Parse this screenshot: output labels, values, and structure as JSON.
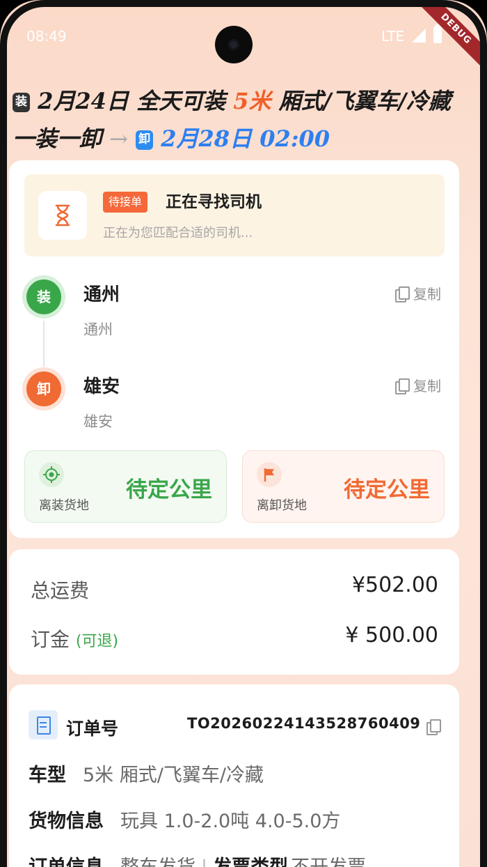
{
  "status_bar": {
    "time": "08:49",
    "network": "LTE"
  },
  "debug_label": "DEBUG",
  "header": {
    "load_tag": "装",
    "load_date": "2月24日",
    "load_window": "全天可装",
    "truck_length": "5米",
    "truck_types": "厢式/飞翼车/冷藏",
    "mode": "一装一卸",
    "arrow": "→",
    "unload_tag": "卸",
    "unload_datetime": "2月28日 02:00"
  },
  "status": {
    "badge": "待接单",
    "title": "正在寻找司机",
    "subtitle": "正在为您匹配合适的司机..."
  },
  "route": {
    "load": {
      "marker": "装",
      "name": "通州",
      "detail": "通州",
      "copy_label": "复制"
    },
    "unload": {
      "marker": "卸",
      "name": "雄安",
      "detail": "雄安",
      "copy_label": "复制"
    }
  },
  "distance": {
    "to_load": {
      "label": "离装货地",
      "value": "待定公里",
      "icon": "location-target-icon"
    },
    "to_unload": {
      "label": "离卸货地",
      "value": "待定公里",
      "icon": "flag-icon"
    }
  },
  "fees": {
    "total_label": "总运费",
    "total_value": "¥502.00",
    "deposit_label": "订金",
    "deposit_note": "(可退)",
    "deposit_value": "¥ 500.00"
  },
  "order": {
    "label": "订单号",
    "number": "TO20260224143528760409",
    "vehicle_key": "车型",
    "vehicle_value": "5米 厢式/飞翼车/冷藏",
    "cargo_key": "货物信息",
    "cargo_value": "玩具 1.0-2.0吨 4.0-5.0方",
    "order_info_key": "订单信息",
    "order_info_value": "整车发货",
    "invoice_key": "发票类型",
    "invoice_value": "不开发票"
  },
  "colors": {
    "green": "#3aa64a",
    "orange": "#f06a33",
    "blue": "#2d7ff0"
  }
}
